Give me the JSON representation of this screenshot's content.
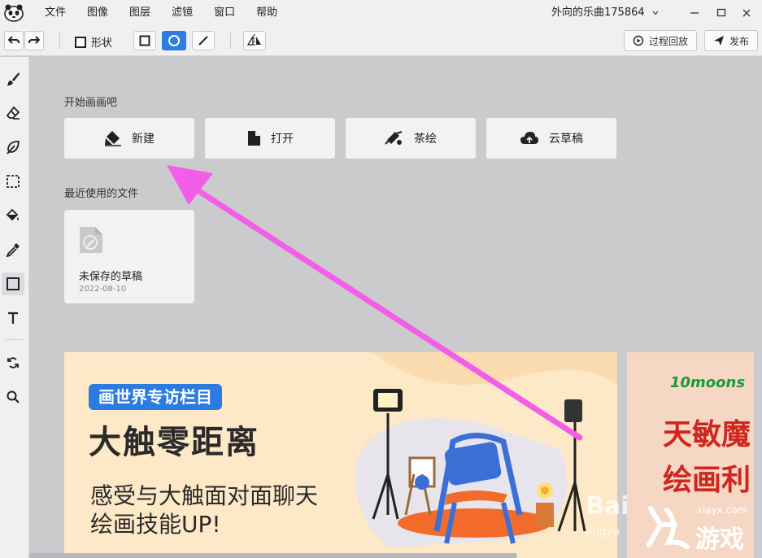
{
  "menubar": {
    "items": [
      "文件",
      "图像",
      "图层",
      "滤镜",
      "窗口",
      "帮助"
    ],
    "user_name": "外向的乐曲175864",
    "user_chevron_icon": "chevron-down-icon",
    "window_controls": [
      "minimize-icon",
      "maximize-icon",
      "close-icon"
    ]
  },
  "toolbar": {
    "undo_icon": "undo-icon",
    "redo_icon": "redo-icon",
    "shape_label": "形状",
    "shape_checked": false,
    "shape_modes": [
      "rectangle",
      "ellipse",
      "line"
    ],
    "active_shape_mode": "ellipse",
    "flip_icon": "flip-horizontal-icon",
    "replay_label": "过程回放",
    "publish_label": "发布"
  },
  "tools": [
    "brush",
    "eraser",
    "smudge",
    "selection",
    "fill",
    "eyedropper",
    "shape",
    "text",
    "transform",
    "zoom"
  ],
  "active_tool": "shape",
  "start": {
    "title": "开始画画吧",
    "buttons": [
      {
        "label": "新建",
        "icon": "new-canvas-icon"
      },
      {
        "label": "打开",
        "icon": "file-icon"
      },
      {
        "label": "茶绘",
        "icon": "tea-art-icon"
      },
      {
        "label": "云草稿",
        "icon": "cloud-upload-icon"
      }
    ]
  },
  "recent": {
    "title": "最近使用的文件",
    "files": [
      {
        "name": "未保存的草稿",
        "date": "2022-08-10"
      }
    ]
  },
  "banners": [
    {
      "tag": "画世界专访栏目",
      "title": "大触零距离",
      "subtitle_line1": "感受与大触面对面聊天",
      "subtitle_line2": "绘画技能UP!"
    },
    {
      "brand": "10moons",
      "line1": "天敏魔",
      "line2": "绘画利"
    }
  ],
  "colors": {
    "accent": "#2f7de1",
    "annotation_arrow": "#f35ee8",
    "banner_bg": "#fde9c7",
    "banner_tag": "#2b7be0"
  },
  "watermarks": {
    "baidu": "Bai",
    "baidu_sub": "jingya",
    "site": "xiayx.com",
    "game": "游戏"
  }
}
